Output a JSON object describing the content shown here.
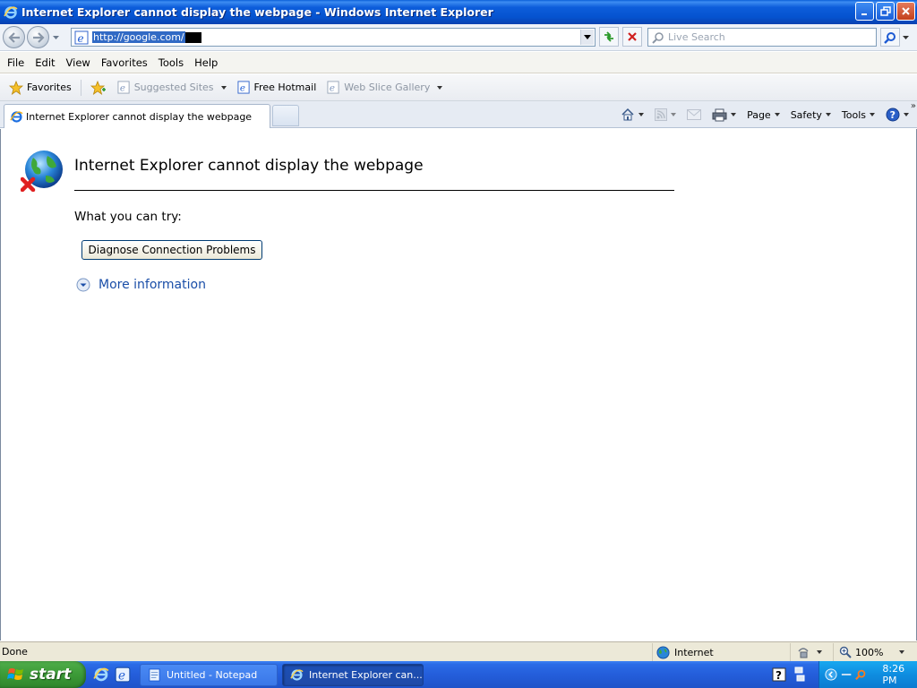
{
  "window": {
    "title": "Internet Explorer cannot display the webpage - Windows Internet Explorer"
  },
  "address_bar": {
    "url": "http://google.com/"
  },
  "search": {
    "placeholder": "Live Search"
  },
  "menu": {
    "items": [
      "File",
      "Edit",
      "View",
      "Favorites",
      "Tools",
      "Help"
    ]
  },
  "favorites_bar": {
    "favorites_label": "Favorites",
    "items": [
      {
        "label": "Suggested Sites",
        "muted": true
      },
      {
        "label": "Free Hotmail",
        "muted": false
      },
      {
        "label": "Web Slice Gallery",
        "muted": true
      }
    ]
  },
  "tab": {
    "title": "Internet Explorer cannot display the webpage"
  },
  "command_bar": {
    "page": "Page",
    "safety": "Safety",
    "tools": "Tools"
  },
  "error_page": {
    "heading": "Internet Explorer cannot display the webpage",
    "try_text": "What you can try:",
    "diagnose_button": "Diagnose Connection Problems",
    "more_info": "More information"
  },
  "status_bar": {
    "status": "Done",
    "zone": "Internet",
    "zoom": "100%"
  },
  "taskbar": {
    "start_label": "start",
    "tasks": [
      "Untitled - Notepad",
      "Internet Explorer can..."
    ],
    "clock": "8:26 PM"
  },
  "colors": {
    "title_bar": "#0553d0",
    "link": "#1a4ea8",
    "start_button": "#3c9a37",
    "taskbar": "#245edb"
  }
}
